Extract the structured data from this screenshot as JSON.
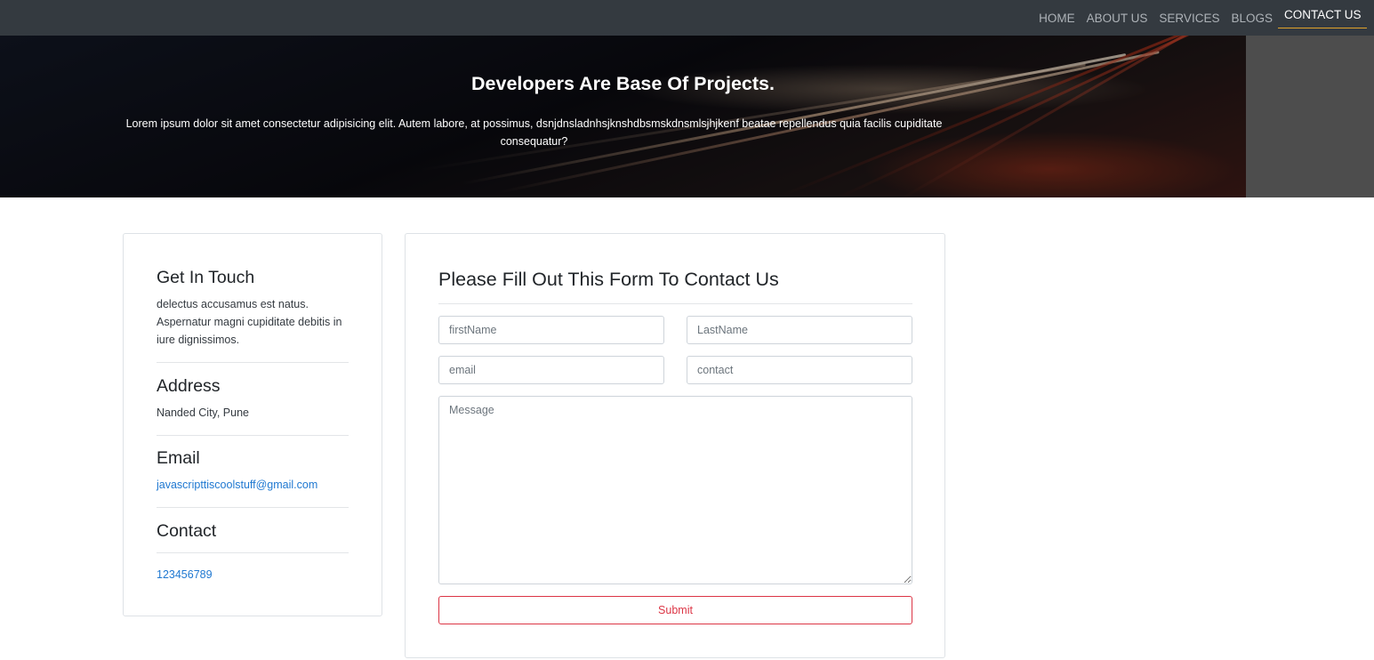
{
  "nav": {
    "items": [
      {
        "label": "HOME"
      },
      {
        "label": "ABOUT US"
      },
      {
        "label": "SERVICES"
      },
      {
        "label": "BLOGS"
      },
      {
        "label": "CONTACT US"
      }
    ],
    "active": "CONTACT US"
  },
  "hero": {
    "title": "Developers Are Base Of Projects.",
    "text": "Lorem ipsum dolor sit amet consectetur adipisicing elit. Autem labore, at possimus, dsnjdnsladnhsjknshdbsmskdnsmlsjhjkenf beatae repellendus quia facilis cupiditate consequatur?"
  },
  "info": {
    "get_in_touch": {
      "heading": "Get In Touch",
      "text": "delectus accusamus est natus. Aspernatur magni cupiditate debitis in iure dignissimos."
    },
    "address": {
      "heading": "Address",
      "text": "Nanded City, Pune"
    },
    "email": {
      "heading": "Email",
      "value": "javascripttiscoolstuff@gmail.com"
    },
    "contact": {
      "heading": "Contact",
      "value": "123456789"
    }
  },
  "form": {
    "title": "Please Fill Out This Form To Contact Us",
    "first_name_placeholder": "firstName",
    "last_name_placeholder": "LastName",
    "email_placeholder": "email",
    "contact_placeholder": "contact",
    "message_placeholder": "Message",
    "submit_label": "Submit"
  },
  "colors": {
    "navbar": "#343a40",
    "active_underline": "#e0a32a",
    "link": "#1f78d1",
    "submit": "#dc3545"
  }
}
